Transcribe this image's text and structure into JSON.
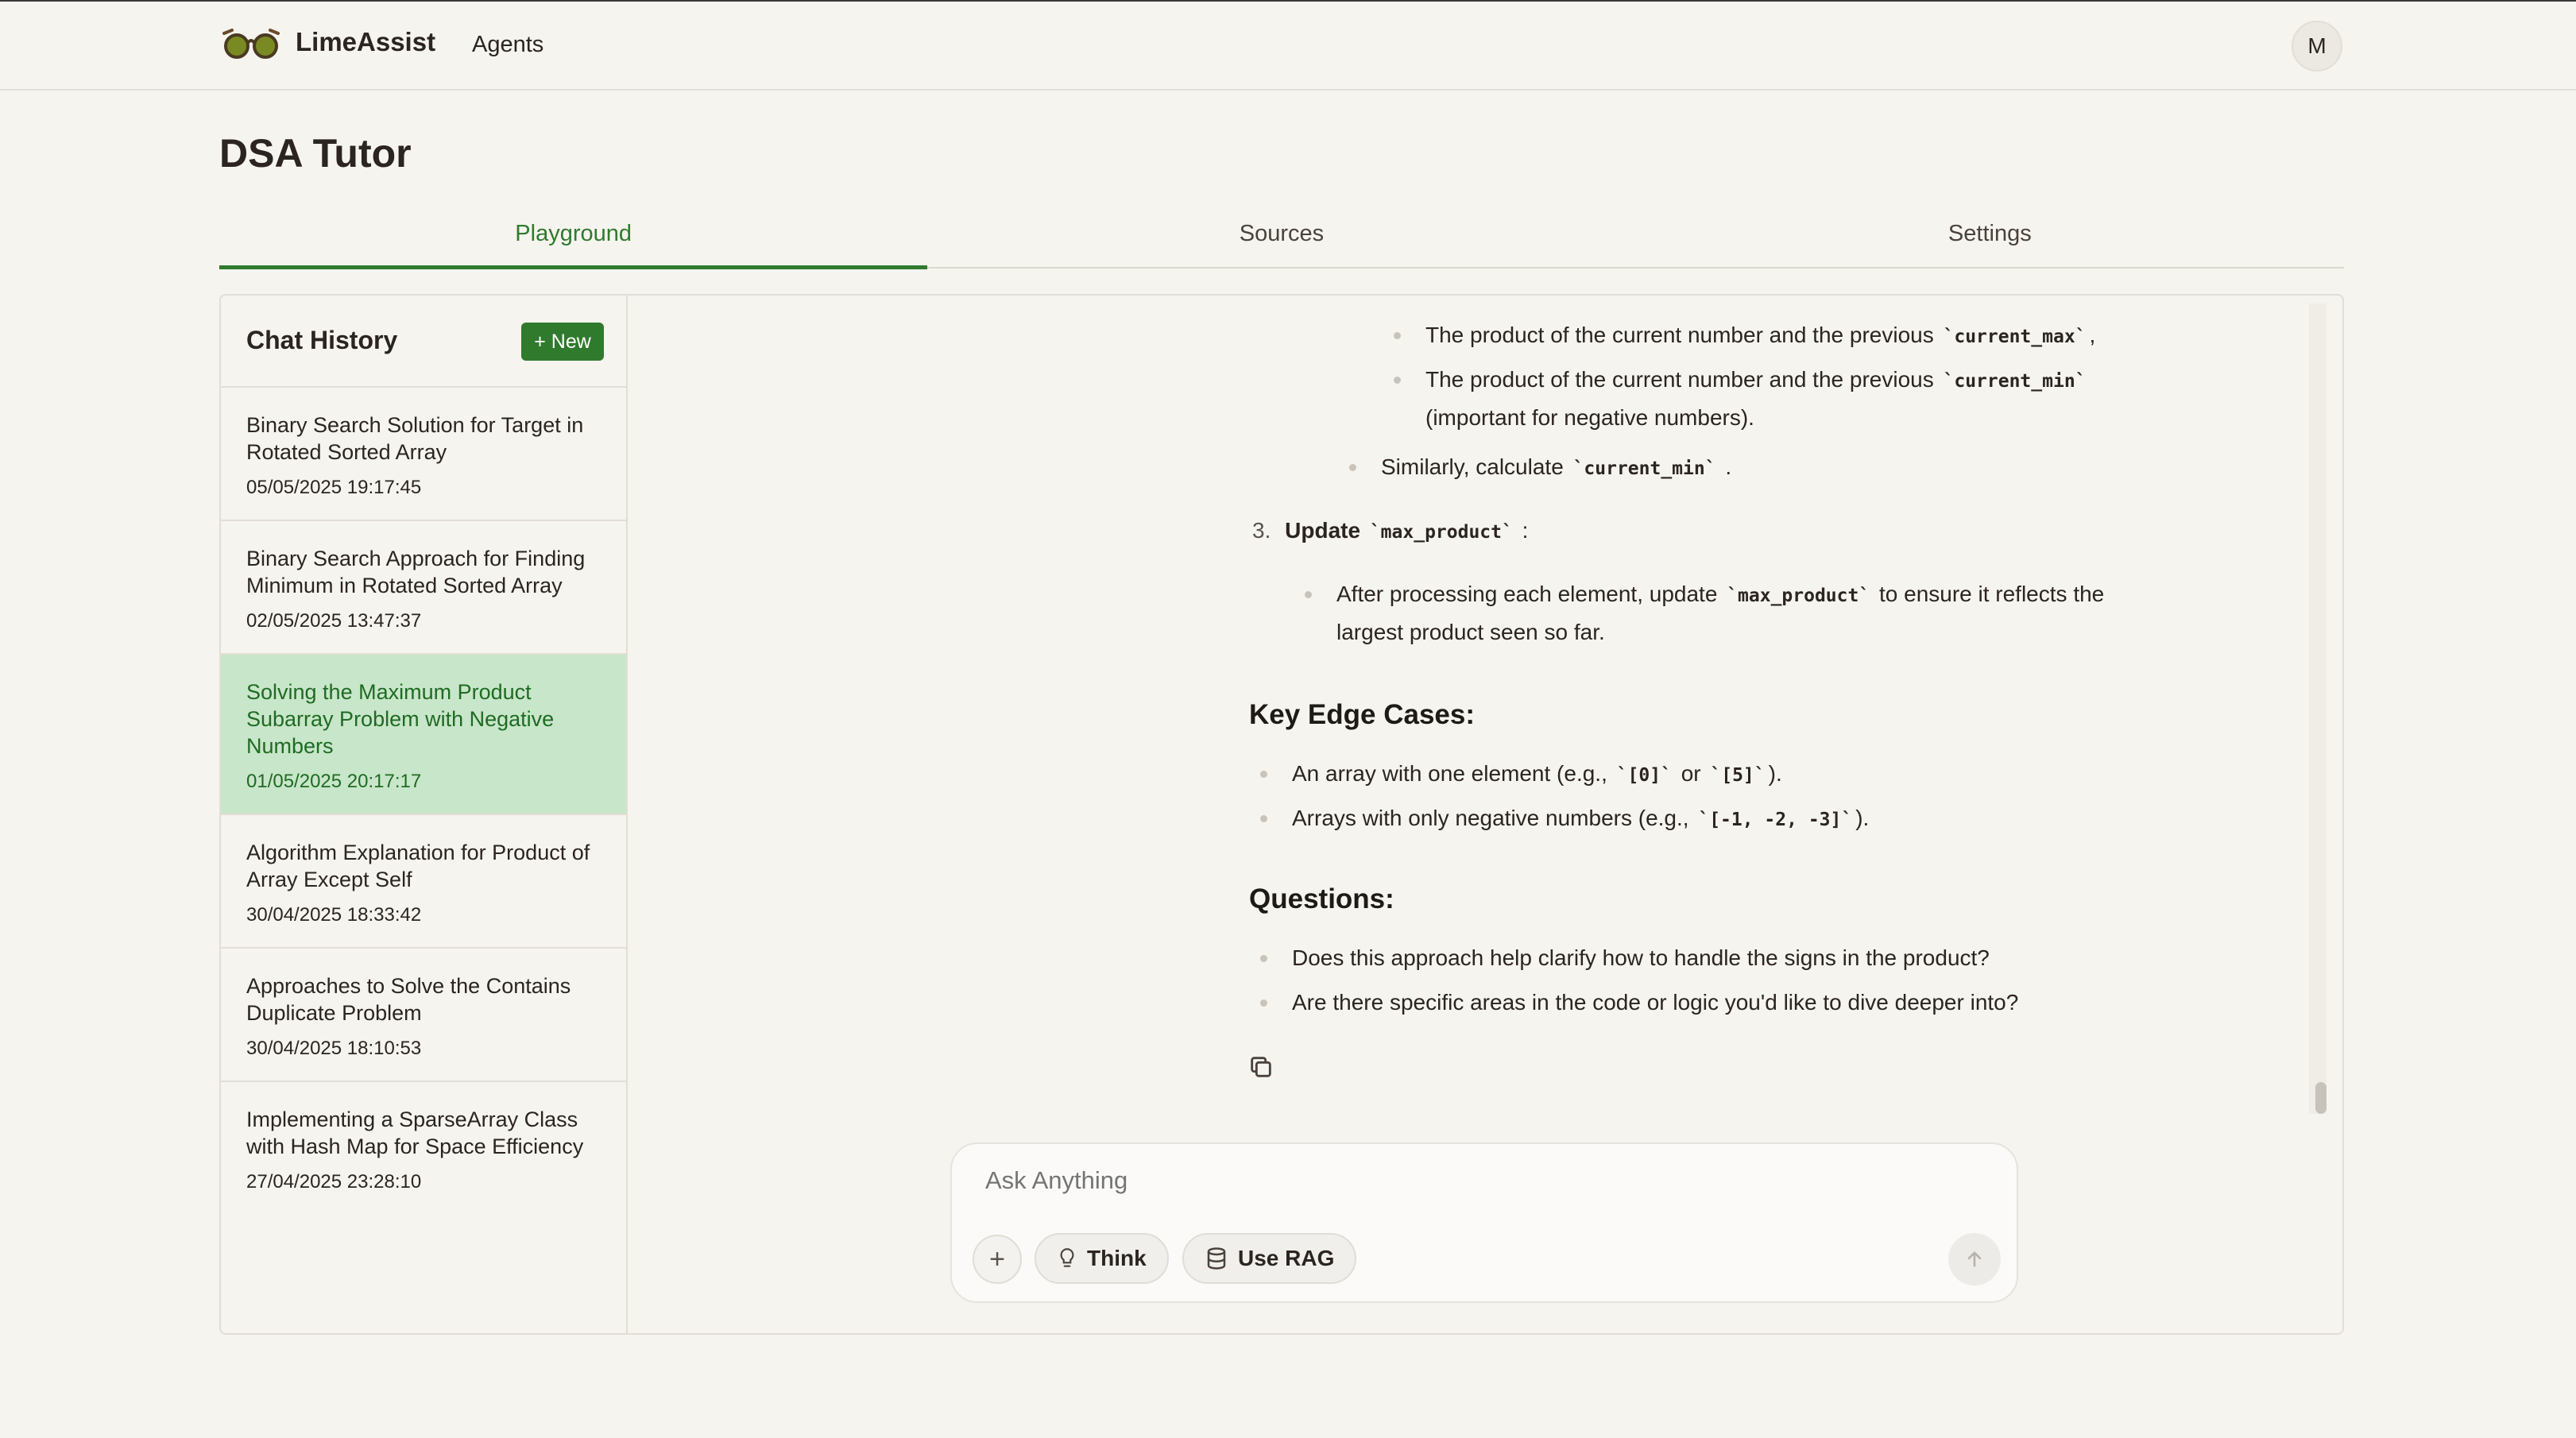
{
  "app": {
    "brand": "LimeAssist",
    "nav_agents": "Agents",
    "avatar_initial": "M"
  },
  "page": {
    "title": "DSA Tutor"
  },
  "tabs": [
    {
      "label": "Playground",
      "active": true
    },
    {
      "label": "Sources",
      "active": false
    },
    {
      "label": "Settings",
      "active": false
    }
  ],
  "sidebar": {
    "title": "Chat History",
    "new_label": "+ New",
    "items": [
      {
        "title": "Binary Search Solution for Target in Rotated Sorted Array",
        "date": "05/05/2025 19:17:45"
      },
      {
        "title": "Binary Search Approach for Finding Minimum in Rotated Sorted Array",
        "date": "02/05/2025 13:47:37"
      },
      {
        "title": "Solving the Maximum Product Subarray Problem with Negative Numbers",
        "date": "01/05/2025 20:17:17",
        "active": true
      },
      {
        "title": "Algorithm Explanation for Product of Array Except Self",
        "date": "30/04/2025 18:33:42"
      },
      {
        "title": "Approaches to Solve the Contains Duplicate Problem",
        "date": "30/04/2025 18:10:53"
      },
      {
        "title": "Implementing a SparseArray Class with Hash Map for Space Efficiency",
        "date": "27/04/2025 23:28:10"
      }
    ]
  },
  "message": {
    "l1_text": "The product of the current number and the previous",
    "l1_code": "`current_max`",
    "l1_tail": ",",
    "l2_text": "The product of the current number and the previous",
    "l2_code": "`current_min`",
    "l2_cont": "(important for negative numbers).",
    "l3_text": "Similarly, calculate",
    "l3_code": "`current_min`",
    "l3_tail": ".",
    "step3_num": "3.",
    "step3_bold": "Update",
    "step3_code": "`max_product`",
    "step3_tail": ":",
    "l4_text": "After processing each element, update",
    "l4_code": "`max_product`",
    "l4_tail": "to ensure it reflects the",
    "l4_cont": "largest product seen so far.",
    "h_edge": "Key Edge Cases:",
    "e1_text": "An array with one element (e.g.,",
    "e1_code1": "`[0]`",
    "e1_or": "or",
    "e1_code2": "`[5]`",
    "e1_tail": ").",
    "e2_text": "Arrays with only negative numbers (e.g.,",
    "e2_code": "`[-1, -2, -3]`",
    "e2_tail": ").",
    "h_q": "Questions:",
    "q1": "Does this approach help clarify how to handle the signs in the product?",
    "q2": "Are there specific areas in the code or logic you'd like to dive deeper into?"
  },
  "composer": {
    "placeholder": "Ask Anything",
    "plus": "+",
    "think": "Think",
    "rag": "Use RAG"
  },
  "colors": {
    "accent": "#2f7a2d",
    "active_item_bg": "#c8e6c9",
    "background": "#f6f4ef"
  }
}
